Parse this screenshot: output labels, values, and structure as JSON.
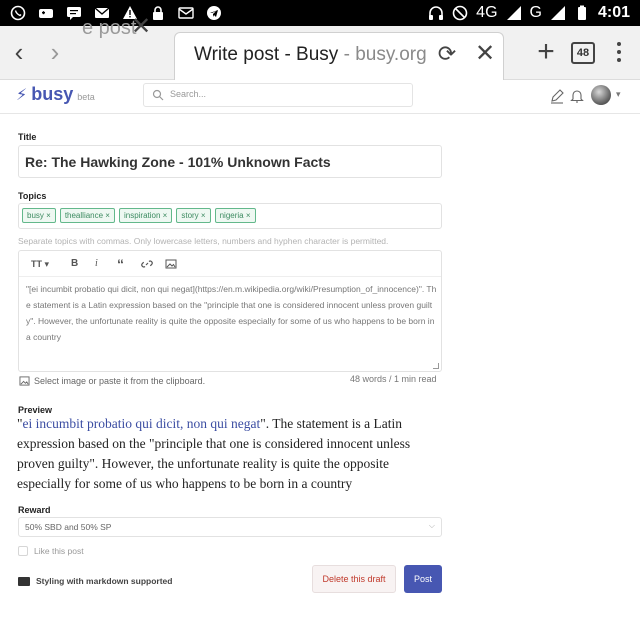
{
  "status_bar": {
    "network": "4G",
    "time": "4:01"
  },
  "browser": {
    "back_icon": "chevron-left-icon",
    "forward_icon": "chevron-right-icon",
    "inactive_tab_title": "e post",
    "active_tab": {
      "title": "Write post - Busy",
      "domain": "busy.org"
    },
    "tab_count": "48"
  },
  "app": {
    "logo": "busy",
    "logo_badge": "beta",
    "search_placeholder": "Search..."
  },
  "editor": {
    "title_label": "Title",
    "title_value": "Re: The Hawking Zone - 101% Unknown Facts",
    "topics_label": "Topics",
    "topics": [
      "busy",
      "thealliance",
      "inspiration",
      "story",
      "nigeria"
    ],
    "topics_hint": "Separate topics with commas. Only lowercase letters, numbers and hyphen character is permitted.",
    "toolbar": {
      "heading": "TT",
      "bold": "B",
      "italic": "i",
      "quote": "“"
    },
    "body": "\"[ei incumbit probatio qui dicit, non qui negat](https://en.m.wikipedia.org/wiki/Presumption_of_innocence)\". The statement is a Latin expression based on the \"principle that one is considered innocent unless proven guilty\". However, the unfortunate reality is quite the opposite especially for some of us who happens to be born in a country",
    "select_image": "Select image or paste it from the clipboard.",
    "word_count": "48 words / 1 min read"
  },
  "preview": {
    "label": "Preview",
    "open_quote": "\"",
    "link_text": "ei incumbit probatio qui dicit, non qui negat",
    "text": "\". The statement is a Latin expression based on the \"principle that one is considered innocent unless proven guilty\". However, the unfortunate reality is quite the opposite especially for some of us who happens to be born in a country"
  },
  "reward": {
    "label": "Reward",
    "selected": "50% SBD and 50% SP"
  },
  "like_post": "Like this post",
  "markdown_note": "Styling with markdown supported",
  "buttons": {
    "delete_draft": "Delete this draft",
    "post": "Post"
  },
  "colors": {
    "brand": "#4757b2",
    "tag_green": "#63b88b",
    "delete_red": "#c0392b"
  }
}
